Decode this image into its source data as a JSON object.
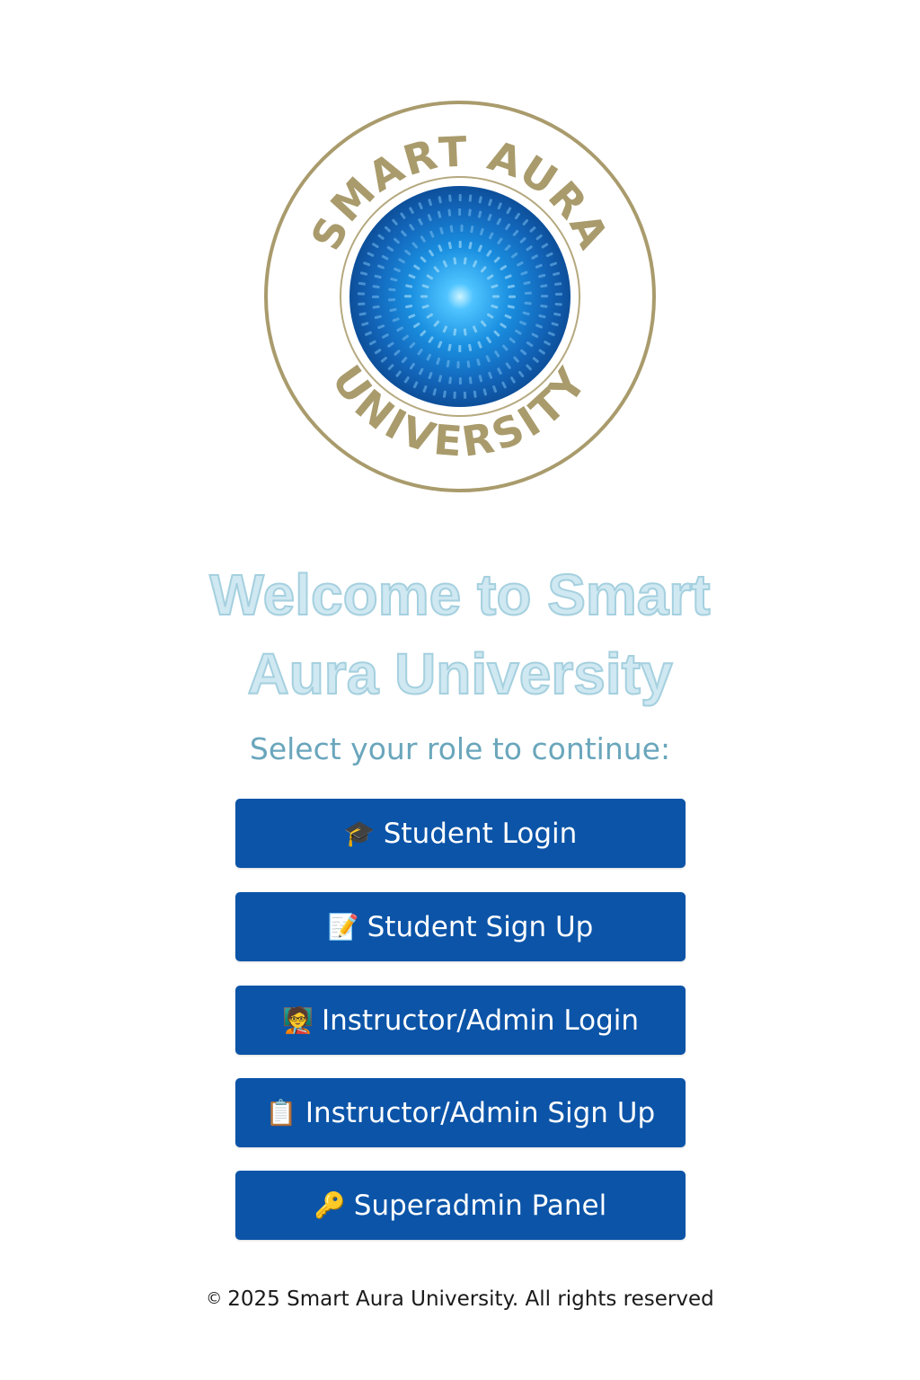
{
  "logo": {
    "top_text": "SMART AURA",
    "bottom_text": "UNIVERSITY",
    "ring_color": "#a99b6c",
    "orb_color": "#1a8fe0",
    "icon": "university-seal-logo"
  },
  "welcome": {
    "line1": "Welcome to Smart",
    "line2": "Aura University"
  },
  "subtitle": "Select your role to continue:",
  "buttons": [
    {
      "emoji": "🎓",
      "icon": "graduation-cap-icon",
      "label": "Student Login"
    },
    {
      "emoji": "📝",
      "icon": "memo-pencil-icon",
      "label": "Student Sign Up"
    },
    {
      "emoji": "🧑‍🏫",
      "icon": "teacher-icon",
      "label": "Instructor/Admin Login"
    },
    {
      "emoji": "📋",
      "icon": "clipboard-icon",
      "label": "Instructor/Admin Sign Up"
    },
    {
      "emoji": "🔑",
      "icon": "key-icon",
      "label": "Superadmin Panel"
    }
  ],
  "footer": {
    "copyright_symbol": "©",
    "text": "2025 Smart Aura University. All rights reserved"
  },
  "colors": {
    "button_bg": "#0b54a8",
    "button_text": "#ffffff",
    "welcome_text": "#cfe8f1",
    "subtitle_text": "#6aa6bc",
    "background": "#ffffff"
  }
}
